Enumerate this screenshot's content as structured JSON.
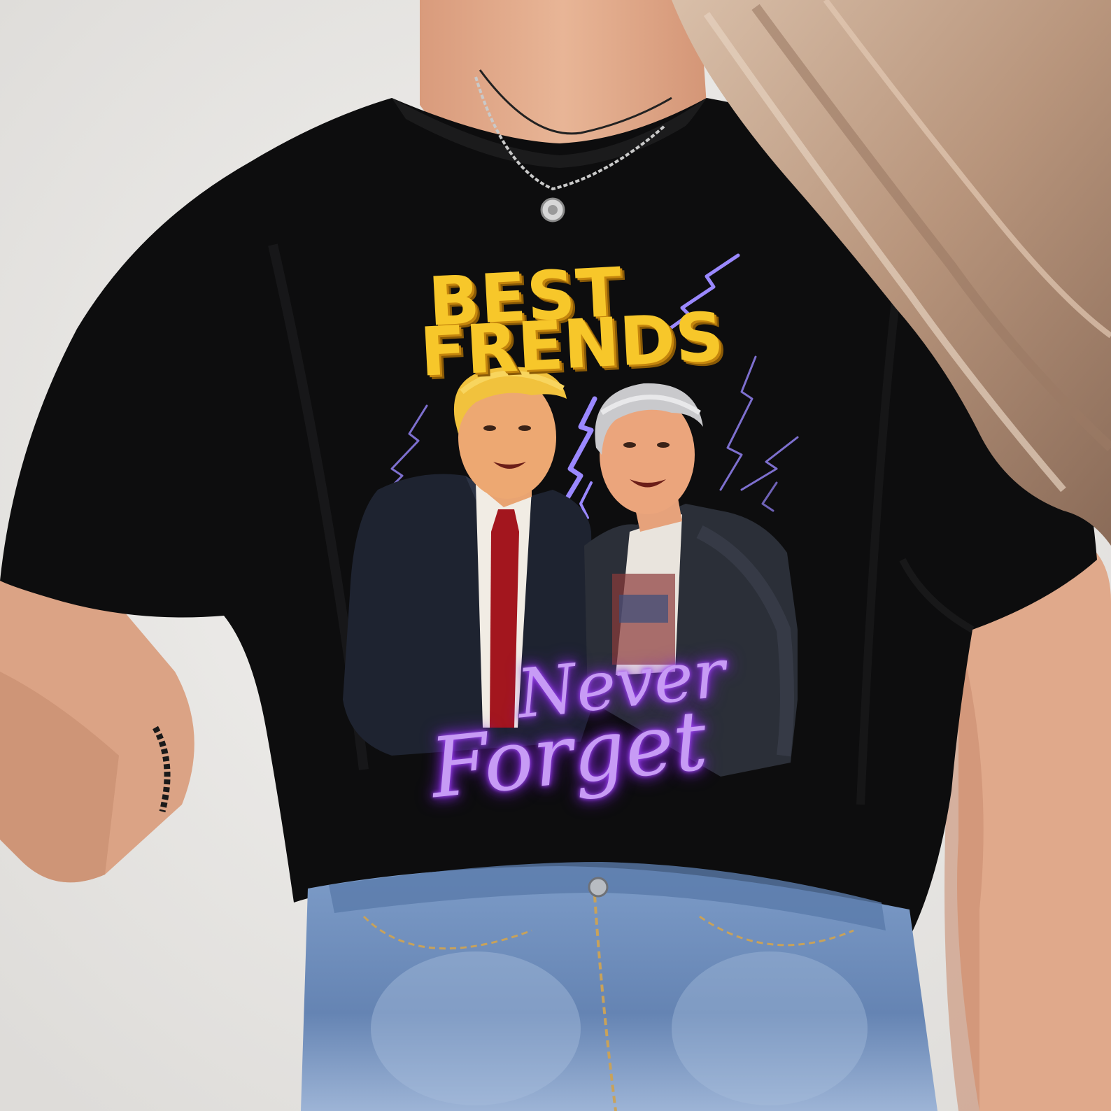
{
  "scene": {
    "subject": "woman wearing black graphic t-shirt and denim jeans",
    "colors": {
      "background": "#ecebe9",
      "shirt": "#0c0c0d",
      "skin": "#e2ab8c",
      "hair": "#c6a58c",
      "denim": "#6f8fbc",
      "headline_yellow": "#f7c72a",
      "neon_purple": "#b57af0",
      "lightning": "#8f7bff"
    }
  },
  "shirt_print": {
    "headline": {
      "line1": "BEST",
      "line2": "FRENDS"
    },
    "tagline": {
      "line1": "Never",
      "line2": "Forget"
    }
  }
}
